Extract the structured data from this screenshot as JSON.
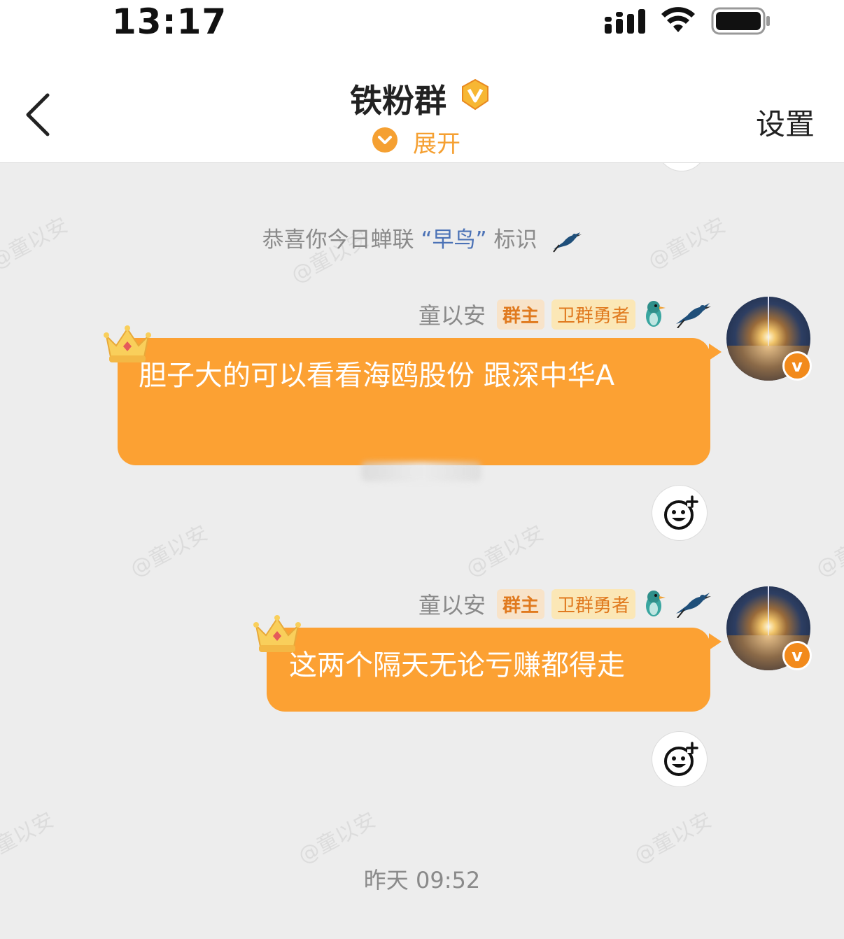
{
  "status_bar": {
    "time": "13:17",
    "icons": [
      "signal-icon",
      "wifi-icon",
      "battery-icon"
    ]
  },
  "header": {
    "back_icon": "back-chevron-icon",
    "title": "铁粉群",
    "badge_icon": "verified-badge-icon",
    "expand_label": "展开",
    "expand_icon": "chevron-down-icon",
    "settings_label": "设置"
  },
  "system_message": {
    "prefix": "恭喜你今日蝉联 ",
    "highlight": "“早鸟”",
    "suffix": " 标识",
    "icon": "early-bird-icon"
  },
  "messages": [
    {
      "sender": "童以安",
      "role_badge": "群主",
      "title_badge": "卫群勇者",
      "badge_icons": [
        "kingfisher-icon",
        "bird-icon"
      ],
      "avatar_badge": "v",
      "text": "胆子大的可以看看海鸥股份 跟深中华A"
    },
    {
      "sender": "童以安",
      "role_badge": "群主",
      "title_badge": "卫群勇者",
      "badge_icons": [
        "kingfisher-icon",
        "bird-icon"
      ],
      "avatar_badge": "v",
      "text": "这两个隔天无论亏赚都得走"
    }
  ],
  "reaction_icon": "add-emoji-icon",
  "timestamp": "昨天 09:52",
  "watermark": "@童以安",
  "colors": {
    "bubble": "#fca133",
    "accent": "#f5a032",
    "background": "#ededed",
    "link": "#4b72b6"
  }
}
